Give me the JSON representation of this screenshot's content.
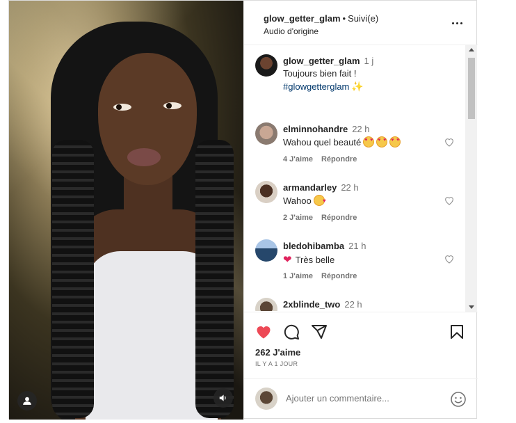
{
  "post": {
    "username": "glow_getter_glam",
    "follow_status": "Suivi(e)",
    "audio": "Audio d'origine",
    "caption": {
      "username": "glow_getter_glam",
      "time": "1 j",
      "line1": "Toujours bien fait !",
      "hashtag": "#glowgetterglam"
    },
    "likes": "262 J'aime",
    "posted_ago": "IL Y A 1 JOUR"
  },
  "comments": [
    {
      "username": "elminnohandre",
      "time": "22 h",
      "text": "Wahou quel beauté",
      "emoji": "smiling-face-with-hearts x3",
      "likes": "4 J'aime",
      "reply": "Répondre"
    },
    {
      "username": "armandarley",
      "time": "22 h",
      "text": "Wahoo",
      "emoji": "face-blowing-kiss",
      "likes": "2 J'aime",
      "reply": "Répondre"
    },
    {
      "username": "bledohibamba",
      "time": "21 h",
      "text": "Très belle",
      "emoji": "red-heart",
      "likes": "1 J'aime",
      "reply": "Répondre"
    },
    {
      "username": "2xblinde_two",
      "time": "22 h"
    }
  ],
  "add_comment": {
    "placeholder": "Ajouter un commentaire..."
  },
  "colors": {
    "like_red": "#ed4956",
    "text": "#262626",
    "muted": "#737373",
    "hashtag": "#00376b",
    "border": "#dbdbdb"
  },
  "icons": [
    "heart-filled-icon",
    "comment-icon",
    "share-icon",
    "bookmark-icon",
    "more-icon",
    "user-tag-icon",
    "volume-icon",
    "emoji-icon",
    "heart-outline-icon"
  ]
}
